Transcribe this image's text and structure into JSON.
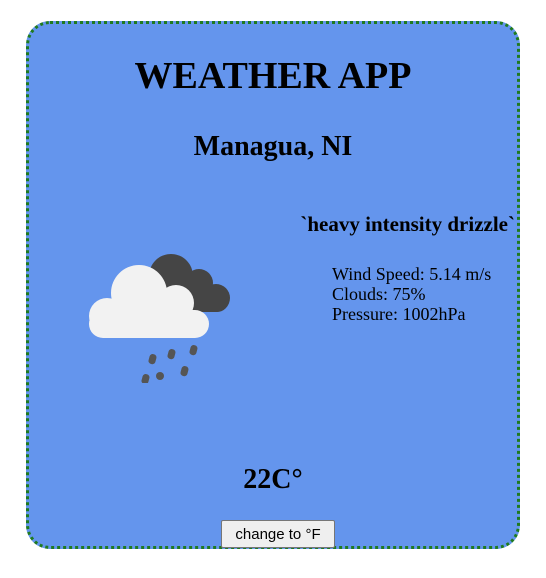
{
  "app": {
    "title": "WEATHER APP"
  },
  "weather": {
    "location": "Managua, NI",
    "description": "`heavy intensity drizzle`",
    "wind_speed": "Wind Speed: 5.14 m/s",
    "clouds": "Clouds: 75%",
    "pressure": "Pressure: 1002hPa",
    "temperature": "22C°",
    "icon": "cloud-drizzle-icon"
  },
  "controls": {
    "unit_toggle_label": "change to °F"
  },
  "colors": {
    "card_background": "#6495ed",
    "card_border": "#1f7a1f",
    "dark_cloud": "#454545",
    "light_cloud": "#f2f2f2",
    "rain_drops": "#555555"
  }
}
